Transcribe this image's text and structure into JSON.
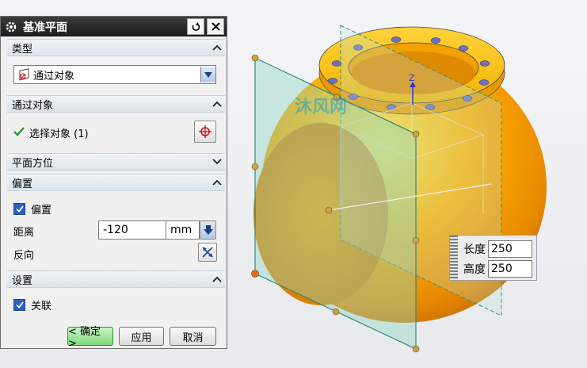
{
  "dialog": {
    "title": "基准平面",
    "sections": {
      "type": "类型",
      "through_object": "通过对象",
      "plane_orientation": "平面方位",
      "offset": "偏置",
      "settings": "设置"
    },
    "type_select_value": "通过对象",
    "select_object_label": "选择对象 (1)",
    "offset_checkbox_label": "偏置",
    "distance_label": "距离",
    "distance_value": "-120",
    "distance_unit": "mm",
    "reverse_label": "反向",
    "associative_label": "关联",
    "buttons": {
      "ok": "< 确定 >",
      "apply": "应用",
      "cancel": "取消"
    }
  },
  "dimension_popup": {
    "length_label": "长度",
    "length_value": "250",
    "height_label": "高度",
    "height_value": "250"
  },
  "viewport": {
    "axis_label": "Z",
    "watermark": "沐风网"
  },
  "colors": {
    "sphere": "#f6a300",
    "plane": "#8fd6c6",
    "accent": "#2962c4"
  }
}
